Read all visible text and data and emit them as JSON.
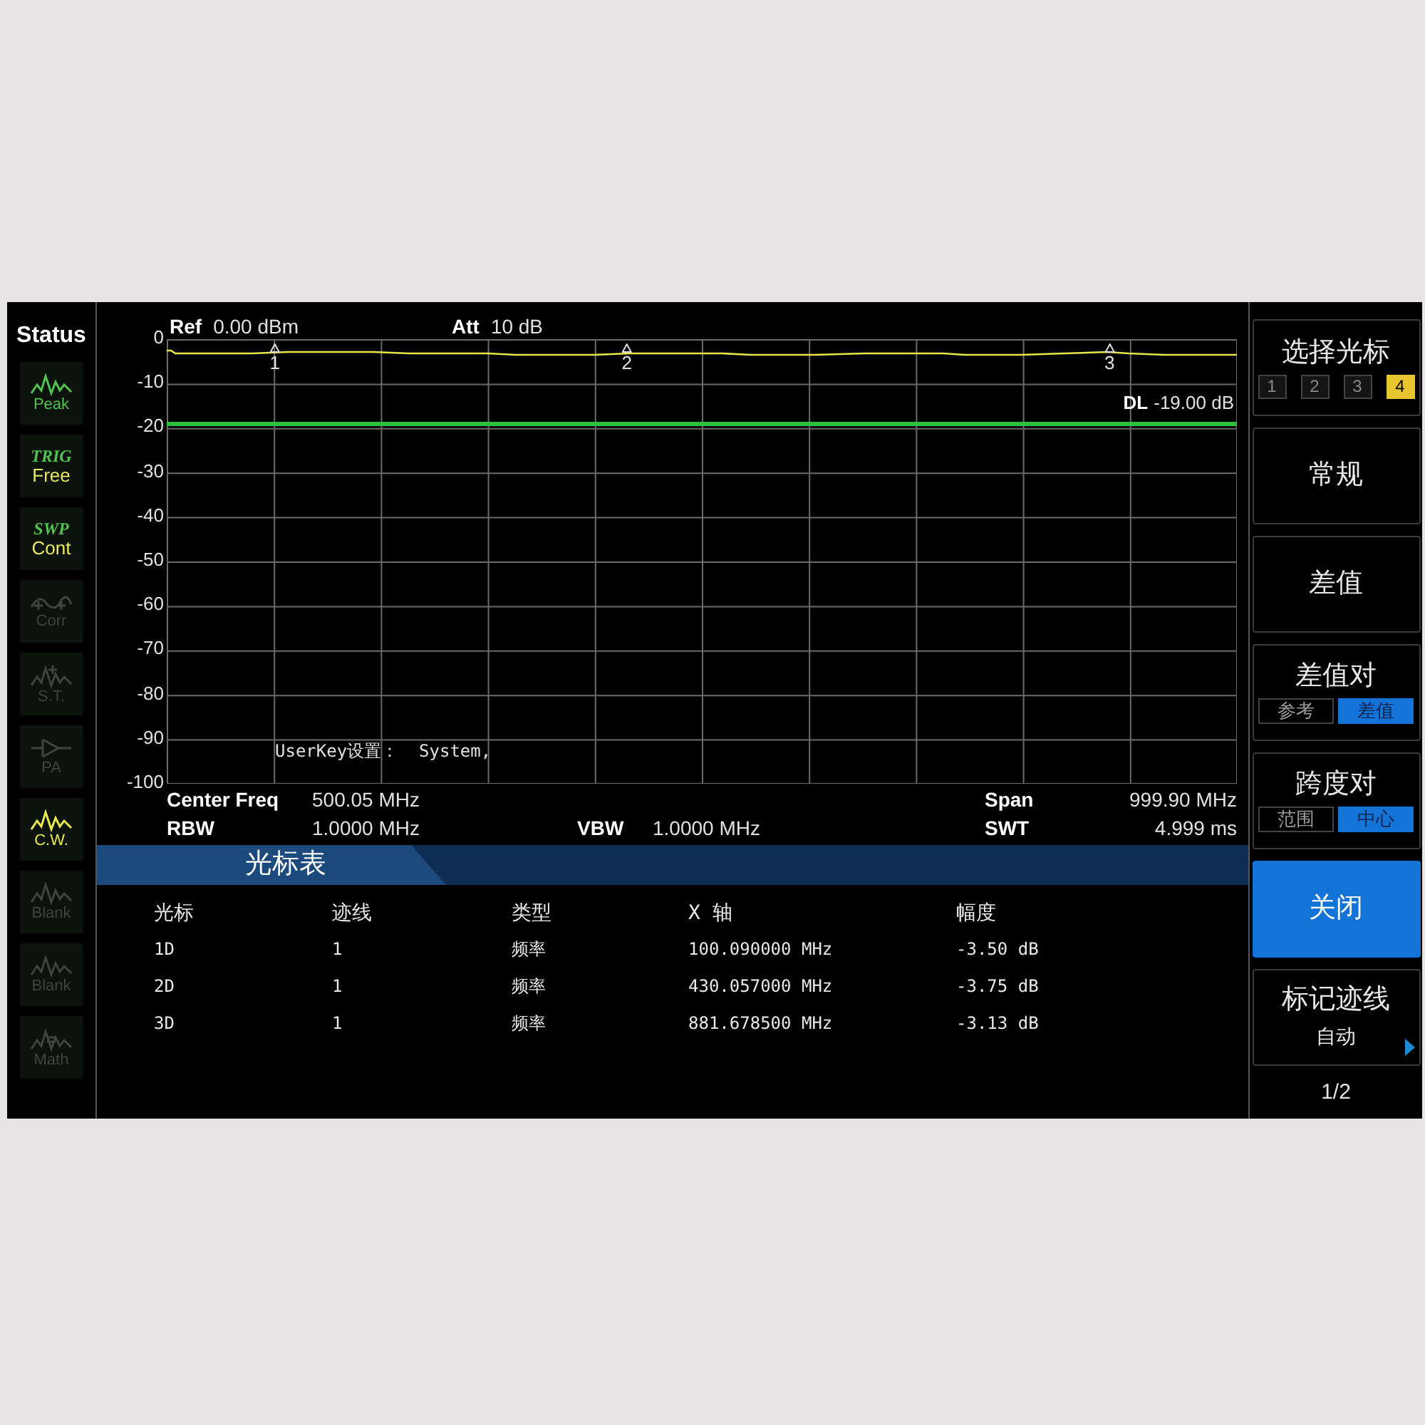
{
  "status": {
    "title": "Status",
    "items": [
      {
        "kind": "wave",
        "label": "Peak",
        "color": "#4fc24f"
      },
      {
        "kind": "text",
        "tag": "TRIG",
        "label": "Free",
        "color": "#e8e860"
      },
      {
        "kind": "text",
        "tag": "SWP",
        "label": "Cont",
        "color": "#e8e860"
      },
      {
        "kind": "corr",
        "label": "Corr",
        "color": "#3c463c"
      },
      {
        "kind": "st",
        "label": "S.T.",
        "color": "#3c463c"
      },
      {
        "kind": "pa",
        "label": "PA",
        "color": "#3c463c"
      },
      {
        "kind": "wave",
        "label": "C.W.",
        "color": "#e8e84a"
      },
      {
        "kind": "wave",
        "label": "Blank",
        "color": "#3c463c"
      },
      {
        "kind": "wave",
        "label": "Blank",
        "color": "#3c463c"
      },
      {
        "kind": "math",
        "label": "Math",
        "color": "#3c463c"
      }
    ]
  },
  "header": [
    {
      "label": "Ref",
      "value": "0.00 dBm"
    },
    {
      "label": "Att",
      "value": "10 dB"
    }
  ],
  "plot": {
    "y_labels": [
      "0",
      "-10",
      "-20",
      "-30",
      "-40",
      "-50",
      "-60",
      "-70",
      "-80",
      "-90",
      "-100"
    ],
    "markers": [
      "1",
      "2",
      "3"
    ],
    "display_line": {
      "label": "DL",
      "value": "-19.00 dB"
    },
    "message": "UserKey设置：  System,"
  },
  "info": [
    [
      {
        "label": "Center Freq",
        "value": "500.05 MHz"
      },
      {
        "label": "Span",
        "value": "999.90 MHz"
      }
    ],
    [
      {
        "label": "RBW",
        "value": "1.0000 MHz"
      },
      {
        "label": "VBW",
        "value": "1.0000 MHz"
      },
      {
        "label": "SWT",
        "value": "4.999 ms"
      }
    ]
  ],
  "table": {
    "title": "光标表",
    "columns": [
      "光标",
      "迹线",
      "类型",
      "X 轴",
      "幅度"
    ],
    "rows": [
      [
        "1D",
        "1",
        "频率",
        "100.090000 MHz",
        "-3.50 dB"
      ],
      [
        "2D",
        "1",
        "频率",
        "430.057000 MHz",
        "-3.75 dB"
      ],
      [
        "3D",
        "1",
        "频率",
        "881.678500 MHz",
        "-3.13 dB"
      ]
    ]
  },
  "softkeys": [
    {
      "kind": "options",
      "label": "选择光标",
      "options": [
        {
          "label": "1",
          "selected": false
        },
        {
          "label": "2",
          "selected": false
        },
        {
          "label": "3",
          "selected": false
        },
        {
          "label": "4",
          "selected": true
        }
      ]
    },
    {
      "kind": "plain",
      "label": "常规",
      "selected": false
    },
    {
      "kind": "plain",
      "label": "差值",
      "selected": false
    },
    {
      "kind": "toggle",
      "label": "差值对",
      "options": [
        {
          "label": "参考",
          "selected": false
        },
        {
          "label": "差值",
          "selected": true
        }
      ]
    },
    {
      "kind": "toggle",
      "label": "跨度对",
      "options": [
        {
          "label": "范围",
          "selected": false
        },
        {
          "label": "中心",
          "selected": true
        }
      ]
    },
    {
      "kind": "plain",
      "label": "关闭",
      "selected": true
    },
    {
      "kind": "value",
      "label": "标记迹线",
      "value": "自动"
    }
  ],
  "page": "1/2"
}
